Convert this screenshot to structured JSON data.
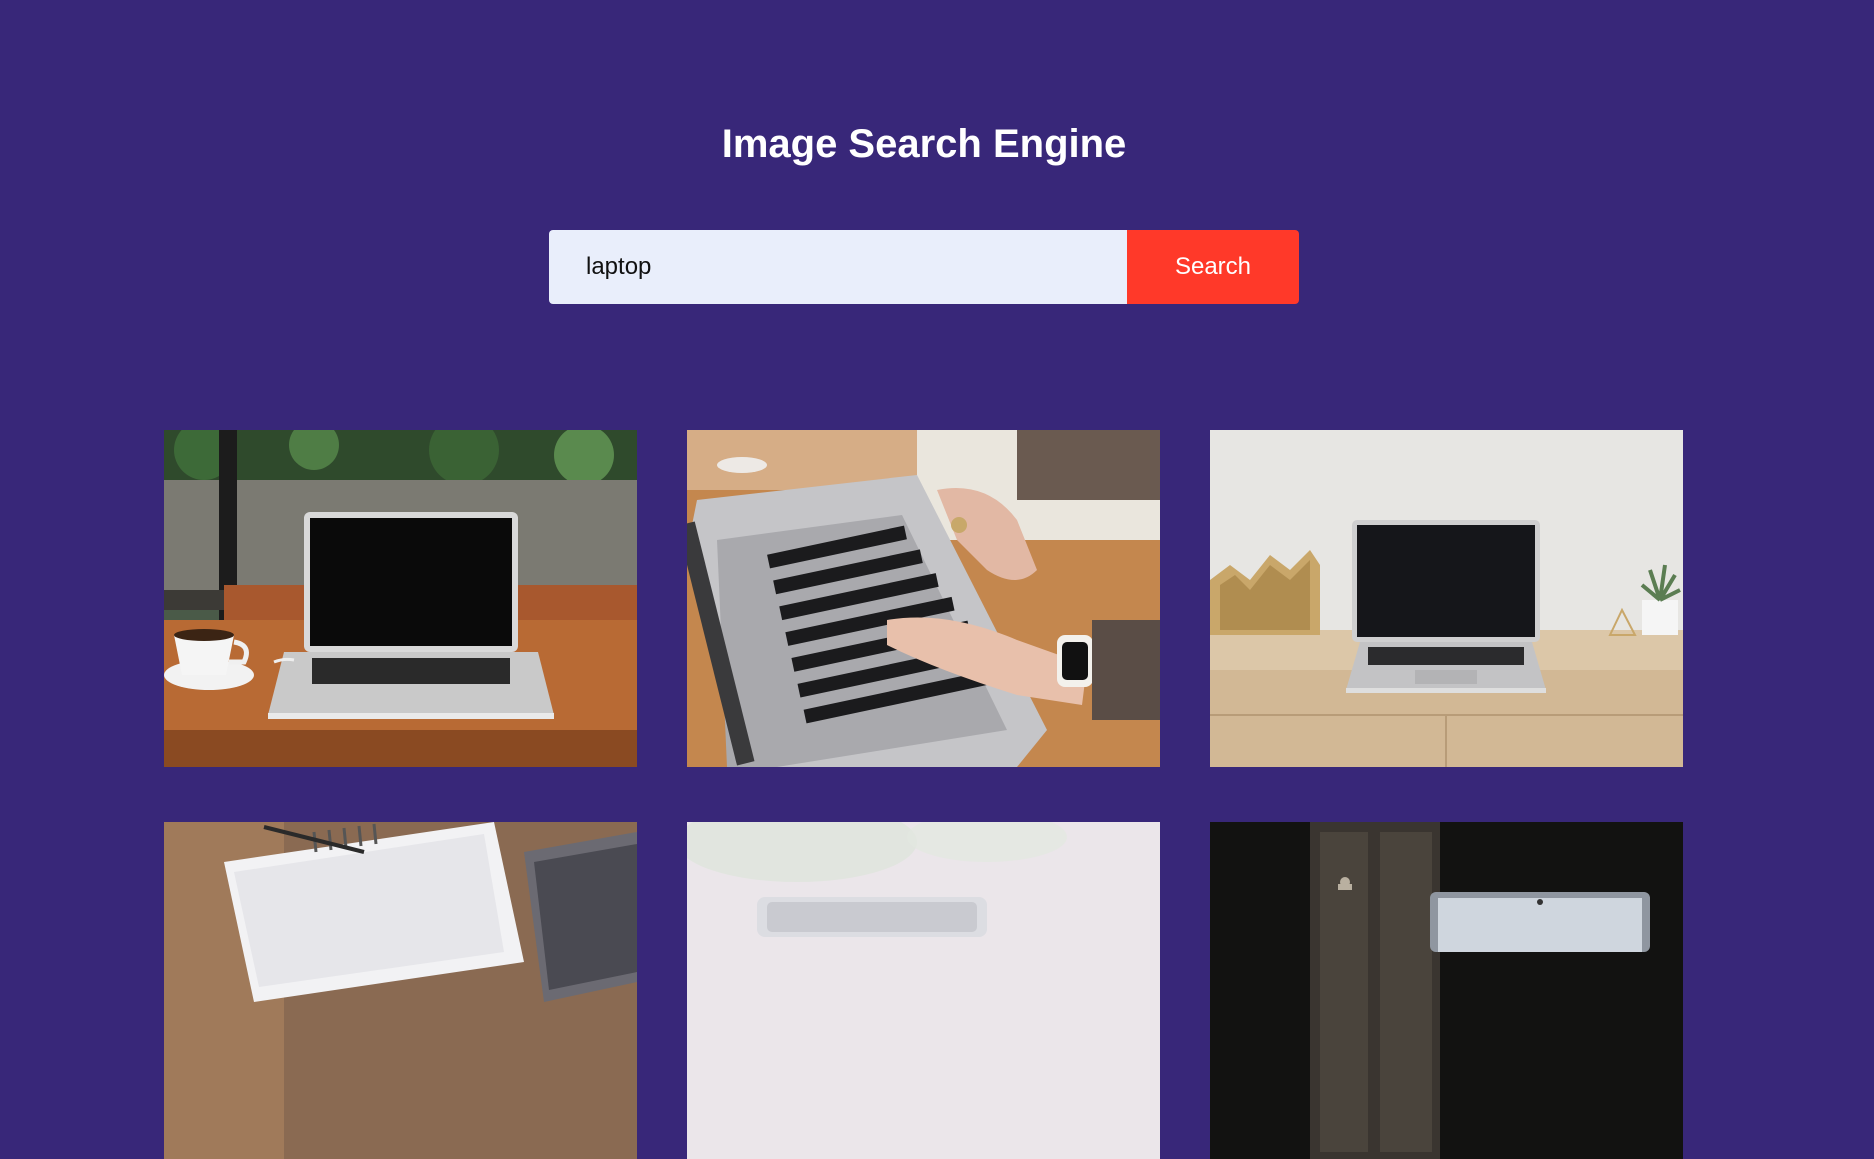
{
  "page": {
    "title": "Image Search Engine"
  },
  "search": {
    "value": "laptop",
    "button_label": "Search"
  },
  "colors": {
    "background": "#382779",
    "input_background": "#e9eefb",
    "button": "#ff3929",
    "text_light": "#ffffff"
  },
  "results": [
    {
      "subject": "laptop on wooden table with coffee cup"
    },
    {
      "subject": "hands typing on laptop keyboard"
    },
    {
      "subject": "laptop on light wooden desk with decor"
    },
    {
      "subject": "notebook and laptop on outdoor table"
    },
    {
      "subject": "laptop in bright blurred room"
    },
    {
      "subject": "laptop in dark room with door"
    }
  ]
}
